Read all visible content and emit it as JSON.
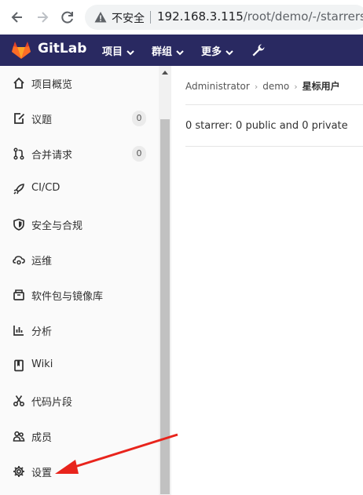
{
  "browser": {
    "back_icon": "arrow-left-icon",
    "forward_icon": "arrow-right-icon",
    "reload_icon": "reload-icon",
    "security_icon": "warning-triangle-icon",
    "security_label": "不安全",
    "url_host": "192.168.3.115",
    "url_path": "/root/demo/-/starrers"
  },
  "topnav": {
    "brand": "GitLab",
    "menus": [
      {
        "label": "项目"
      },
      {
        "label": "群组"
      },
      {
        "label": "更多"
      }
    ],
    "admin_icon": "wrench-icon",
    "background": "#292961"
  },
  "sidebar": {
    "items": [
      {
        "label": "项目概览",
        "icon": "home-icon"
      },
      {
        "label": "议题",
        "icon": "issues-icon",
        "badge": "0"
      },
      {
        "label": "合并请求",
        "icon": "merge-request-icon",
        "badge": "0"
      },
      {
        "label": "CI/CD",
        "icon": "rocket-icon"
      },
      {
        "label": "安全与合规",
        "icon": "shield-icon"
      },
      {
        "label": "运维",
        "icon": "cloud-gear-icon"
      },
      {
        "label": "软件包与镜像库",
        "icon": "package-icon"
      },
      {
        "label": "分析",
        "icon": "chart-icon"
      },
      {
        "label": "Wiki",
        "icon": "book-icon"
      },
      {
        "label": "代码片段",
        "icon": "scissors-icon"
      },
      {
        "label": "成员",
        "icon": "users-icon"
      },
      {
        "label": "设置",
        "icon": "gear-icon"
      }
    ]
  },
  "main": {
    "breadcrumb": [
      "Administrator",
      "demo",
      "星标用户"
    ],
    "starrer_summary": "0 starrer: 0 public and 0 private"
  },
  "annotation": {
    "color": "#e8241c",
    "points_to": "设置"
  }
}
